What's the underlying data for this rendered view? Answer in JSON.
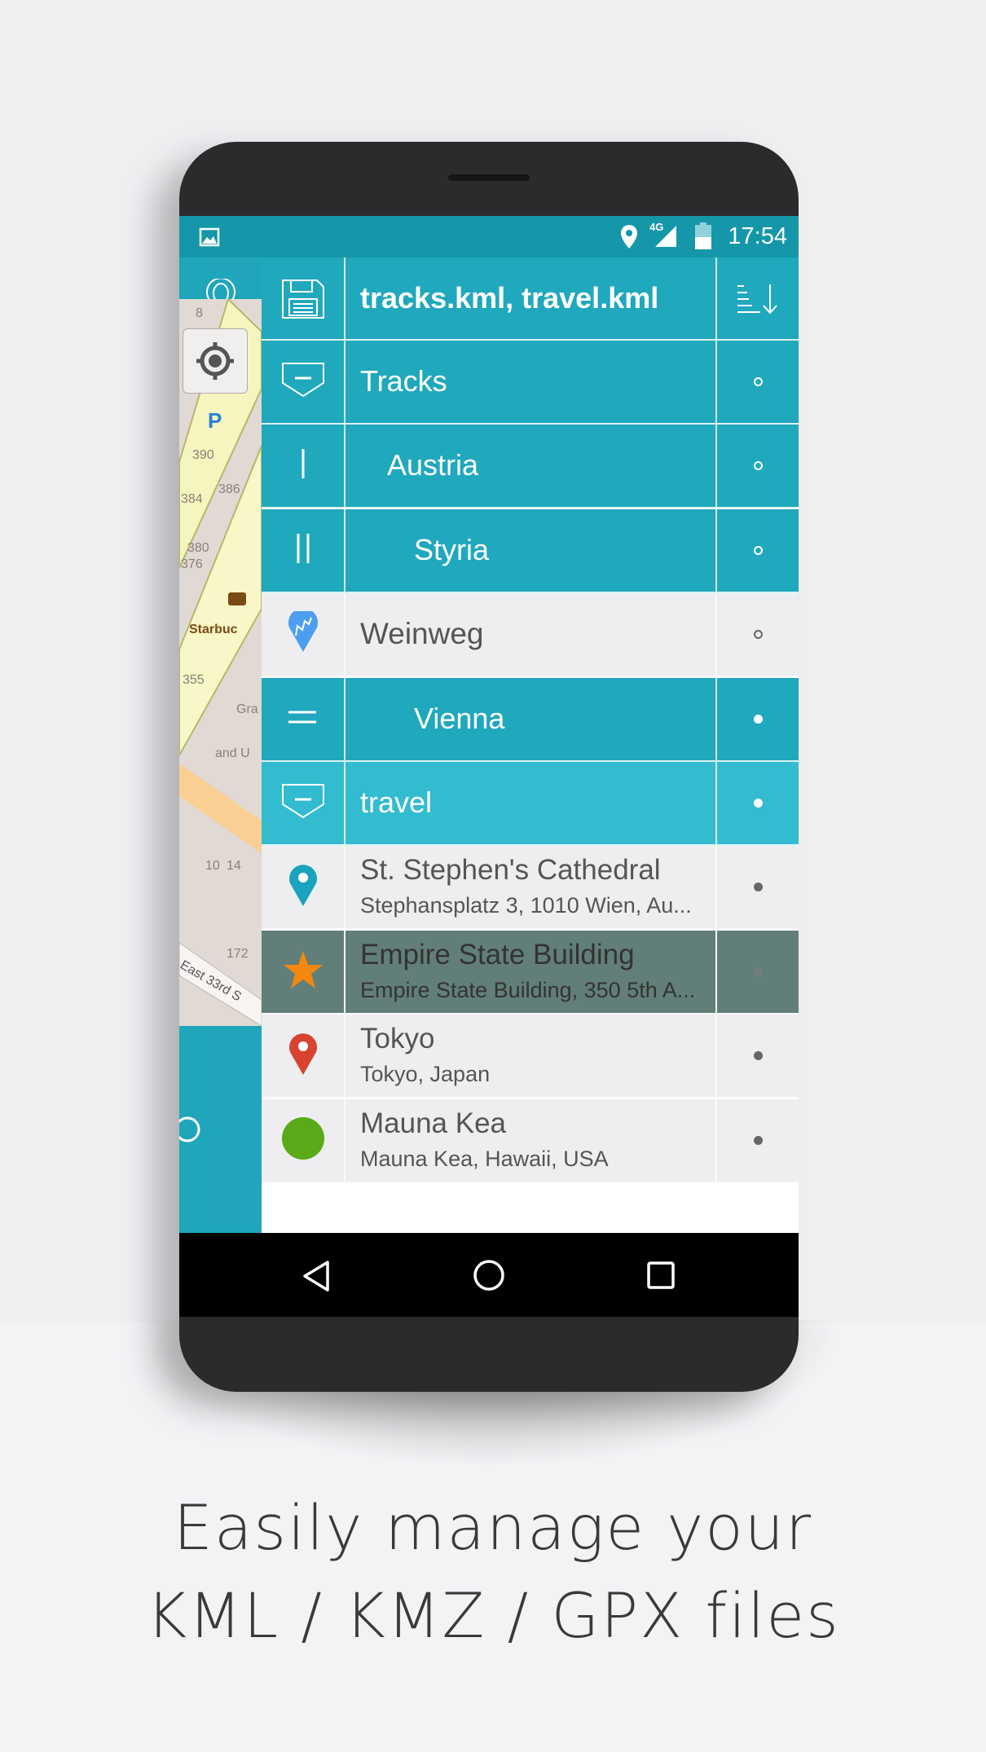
{
  "status_bar": {
    "time": "17:54",
    "network": "4G",
    "icons": [
      "image-icon",
      "location-icon",
      "signal-icon",
      "battery-icon"
    ]
  },
  "header": {
    "title": "tracks.kml, travel.kml",
    "icons": [
      "save-icon",
      "sort-icon"
    ]
  },
  "rail": {
    "icons": [
      "pin-icon",
      "locate-icon",
      "compass-icon"
    ]
  },
  "map_labels": [
    "8",
    "390",
    "386",
    "384",
    "380",
    "376",
    "Starbuc",
    "355",
    "Gra",
    "and U",
    "172",
    "East 33rd S",
    "10",
    "14"
  ],
  "list": [
    {
      "label": "Tracks",
      "type": "folder",
      "level": 0,
      "style": "teal",
      "icon": "folder-collapse-icon"
    },
    {
      "label": "Austria",
      "type": "folder",
      "level": 1,
      "style": "teal",
      "icon": "level1-icon"
    },
    {
      "label": "Styria",
      "type": "folder",
      "level": 2,
      "style": "teal",
      "icon": "level2-icon"
    },
    {
      "label": "Weinweg",
      "type": "track",
      "level": 0,
      "style": "light",
      "icon": "track-pin-icon"
    },
    {
      "label": "Vienna",
      "type": "folder",
      "level": 2,
      "style": "teal",
      "icon": "level-equal-icon"
    },
    {
      "label": "travel",
      "type": "folder",
      "level": 0,
      "style": "teal-light",
      "icon": "folder-collapse-icon"
    },
    {
      "label": "St. Stephen's Cathedral",
      "subtitle": "Stephansplatz 3, 1010 Wien, Au...",
      "style": "light",
      "icon": "teal-pin-icon"
    },
    {
      "label": "Empire State Building",
      "subtitle": "Empire State Building, 350 5th A...",
      "style": "selected",
      "icon": "orange-star-icon"
    },
    {
      "label": "Tokyo",
      "subtitle": "Tokyo, Japan",
      "style": "light",
      "icon": "red-pin-icon"
    },
    {
      "label": "Mauna Kea",
      "subtitle": "Mauna Kea, Hawaii, USA",
      "style": "light",
      "icon": "green-circle-icon"
    }
  ],
  "nav": {
    "icons": [
      "back-icon",
      "home-icon",
      "recents-icon"
    ]
  },
  "caption": {
    "line1": "Easily manage your",
    "line2": "KML / KMZ / GPX files"
  },
  "colors": {
    "teal": "#20a8bd",
    "teal_light": "#33bbd0",
    "status": "#1597a9",
    "selected": "#617f78",
    "star": "#f4880f",
    "red_pin": "#d8432f",
    "green": "#5aa918",
    "blue_pin": "#4c9ef0"
  }
}
